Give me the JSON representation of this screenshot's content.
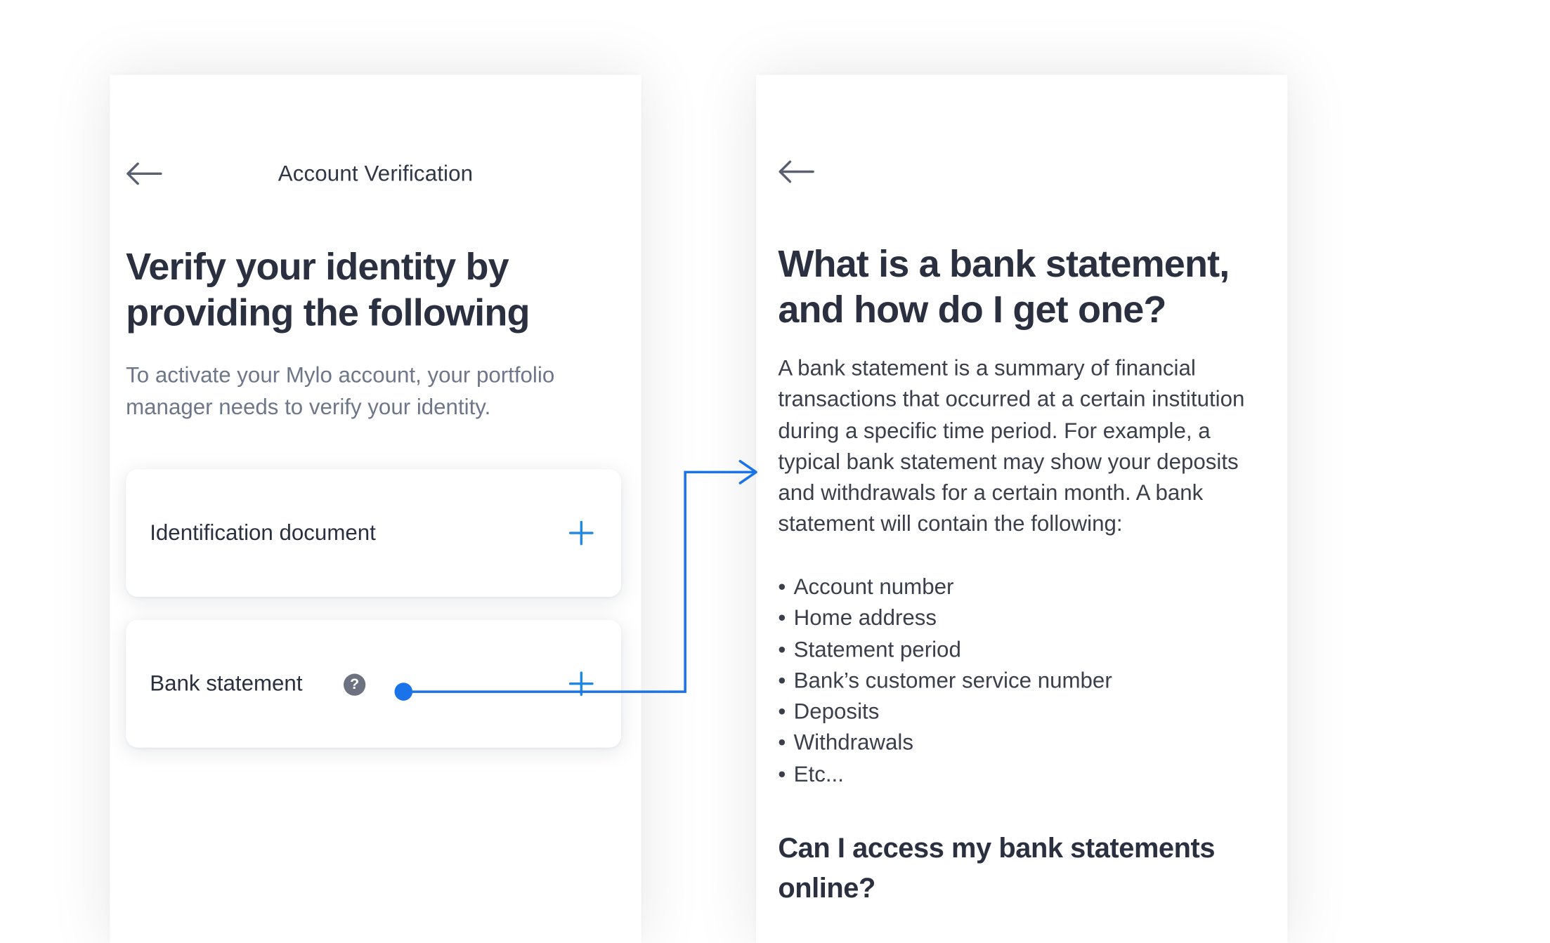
{
  "left_screen": {
    "topbar_title": "Account Verification",
    "heading_line1": "Verify your identity by",
    "heading_line2": "providing the following",
    "subtitle": "To activate your Mylo account, your portfolio manager needs to verify your identity.",
    "cards": [
      {
        "label": "Identification document",
        "action_icon": "plus-icon"
      },
      {
        "label": "Bank statement",
        "help_icon": "?",
        "action_icon": "plus-icon"
      }
    ]
  },
  "right_screen": {
    "heading_line1": "What is a bank statement,",
    "heading_line2": "and how do I get one?",
    "body": "A bank statement is a summary of financial transactions that occurred at a certain institution during a specific time period. For example, a typical bank statement may show your deposits and withdrawals for a certain month. A bank statement will contain the following:",
    "bullets": [
      "Account number",
      "Home address",
      "Statement period",
      "Bank’s customer service number",
      "Deposits",
      "Withdrawals",
      "Etc..."
    ],
    "section_heading": "Can I access my bank statements online?"
  },
  "colors": {
    "accent": "#1e88e5",
    "connector": "#1a73e8",
    "heading": "#2b3040",
    "muted": "#6e7689",
    "background": "#ffffff"
  }
}
